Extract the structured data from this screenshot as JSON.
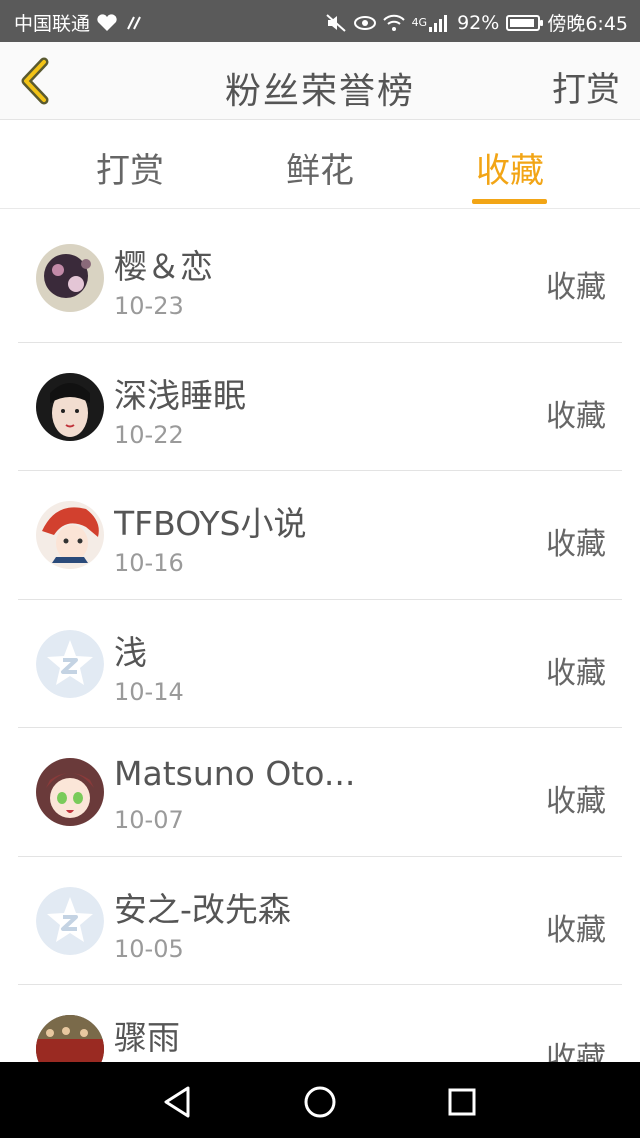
{
  "status_bar": {
    "carrier": "中国联通",
    "battery": "92%",
    "time": "傍晚6:45",
    "network": "4G",
    "battery_level": 0.92
  },
  "header": {
    "title": "粉丝荣誉榜",
    "action_label": "打赏"
  },
  "tabs": [
    {
      "label": "打赏"
    },
    {
      "label": "鲜花"
    },
    {
      "label": "收藏"
    }
  ],
  "active_tab_color": "#f2a516",
  "list": [
    {
      "name": "樱＆恋",
      "date": "10-23",
      "action": "收藏",
      "avatar": "photo-avatar-flowers"
    },
    {
      "name": "深浅睡眠",
      "date": "10-22",
      "action": "收藏",
      "avatar": "photo-avatar-lady"
    },
    {
      "name": "TFBOYS小说",
      "date": "10-16",
      "action": "收藏",
      "avatar": "photo-avatar-anime-boy"
    },
    {
      "name": "浅",
      "date": "10-14",
      "action": "收藏",
      "avatar": "default-avatar"
    },
    {
      "name": "Matsuno Oto...",
      "date": "10-07",
      "action": "收藏",
      "avatar": "photo-avatar-anime-girl"
    },
    {
      "name": "安之-改先森",
      "date": "10-05",
      "action": "收藏",
      "avatar": "default-avatar"
    },
    {
      "name": "骤雨",
      "date": "",
      "action": "收藏",
      "avatar": "photo-avatar-crowd"
    }
  ]
}
